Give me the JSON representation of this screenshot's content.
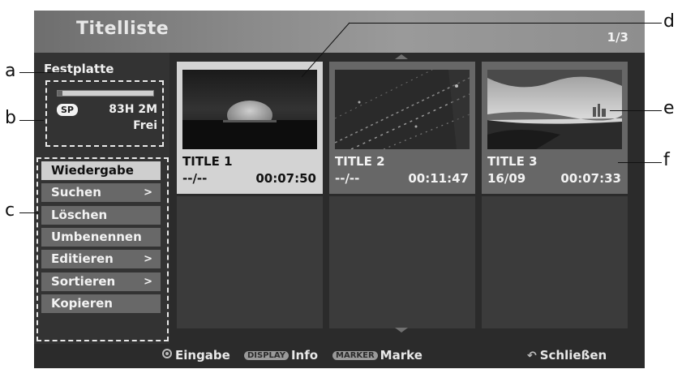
{
  "header": {
    "title": "Titelliste",
    "page": "1/3"
  },
  "sidebar": {
    "device": "Festplatte",
    "capacity_used_fraction": 0.05,
    "record_mode_badge": "SP",
    "remaining_time": "83H 2M",
    "free_label": "Frei",
    "menu": [
      {
        "label": "Wiedergabe",
        "has_submenu": false,
        "active": true
      },
      {
        "label": "Suchen",
        "has_submenu": true,
        "active": false
      },
      {
        "label": "Löschen",
        "has_submenu": false,
        "active": false
      },
      {
        "label": "Umbenennen",
        "has_submenu": false,
        "active": false
      },
      {
        "label": "Editieren",
        "has_submenu": true,
        "active": false
      },
      {
        "label": "Sortieren",
        "has_submenu": true,
        "active": false
      },
      {
        "label": "Kopieren",
        "has_submenu": false,
        "active": false
      }
    ],
    "submenu_arrow": ">"
  },
  "titles": [
    {
      "title": "TITLE 1",
      "date": "--/--",
      "duration": "00:07:50",
      "selected": true
    },
    {
      "title": "TITLE 2",
      "date": "--/--",
      "duration": "00:11:47",
      "selected": false
    },
    {
      "title": "TITLE 3",
      "date": "16/09",
      "duration": "00:07:33",
      "selected": false
    }
  ],
  "footer": {
    "enter_label": "Eingabe",
    "display_key": "DISPLAY",
    "display_label": "Info",
    "marker_key": "MARKER",
    "marker_label": "Marke",
    "close_label": "Schließen"
  },
  "callouts": {
    "a": "a",
    "b": "b",
    "c": "c",
    "d": "d",
    "e": "e",
    "f": "f"
  },
  "colors": {
    "selected_bg": "#d3d3d3",
    "item_bg": "#676767",
    "panel_bg": "#2b2b2b",
    "active_menu_bg": "#cfcfcf"
  }
}
